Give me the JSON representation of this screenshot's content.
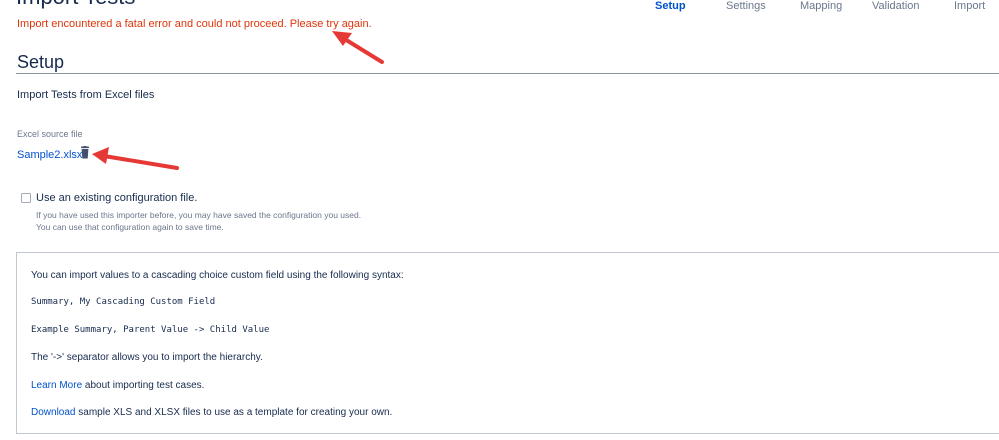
{
  "tabs": {
    "setup": "Setup",
    "settings": "Settings",
    "mapping": "Mapping",
    "validation": "Validation",
    "import": "Import"
  },
  "error_message": "Import encountered a fatal error and could not proceed. Please try again.",
  "section_title": "Setup",
  "subtitle": "Import Tests from Excel files",
  "source_file": {
    "label": "Excel source file",
    "file_name": "Sample2.xlsx",
    "delete_icon": "trash-icon"
  },
  "config_option": {
    "label": "Use an existing configuration file.",
    "checked": false,
    "help_line_1": "If you have used this importer before, you may have saved the configuration you used.",
    "help_line_2": "You can use that configuration again to save time."
  },
  "info": {
    "intro": "You can import values to a cascading choice custom field using the following syntax:",
    "syntax_1": "Summary, My Cascading Custom Field",
    "syntax_2": "Example Summary, Parent Value -> Child Value",
    "separator_note": "The '->' separator allows you to import the hierarchy.",
    "learn_more_link": "Learn More",
    "learn_more_text": " about importing test cases.",
    "download_link": "Download",
    "download_text": " sample XLS and XLSX files to use as a template for creating your own."
  },
  "colors": {
    "accent": "#0052cc",
    "error": "#de350b",
    "annotation_arrow": "#e53935"
  }
}
